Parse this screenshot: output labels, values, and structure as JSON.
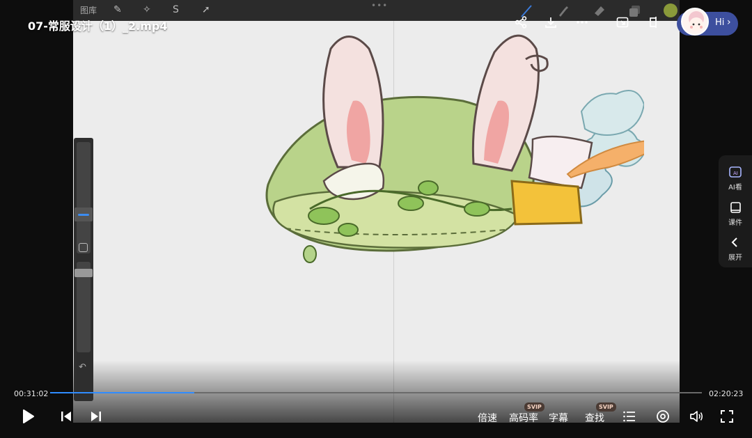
{
  "player": {
    "title": "07-常服设计（1）_2.mp4",
    "current_time": "00:31:02",
    "total_time": "02:20:23",
    "progress": 0.221
  },
  "video_ui": {
    "gallery_label": "图库"
  },
  "top_actions": [
    {
      "name": "share-icon"
    },
    {
      "name": "download-icon"
    },
    {
      "name": "more-icon"
    },
    {
      "name": "picture-in-picture-icon"
    },
    {
      "name": "window-icon"
    }
  ],
  "assistant": {
    "label": "Hi",
    "chevron": "›"
  },
  "right_panel": {
    "ai_label": "AI看",
    "courseware_label": "课件",
    "expand_label": "展开"
  },
  "controls": {
    "speed_label": "倍速",
    "quality_label": "高码率",
    "subtitle_label": "字幕",
    "search_label": "查找",
    "svip_badge": "SVIP"
  },
  "colors": {
    "accent": "#2f8cff",
    "assistant_bg": "#3d4f9e",
    "svip_bg": "#4a3a33"
  }
}
